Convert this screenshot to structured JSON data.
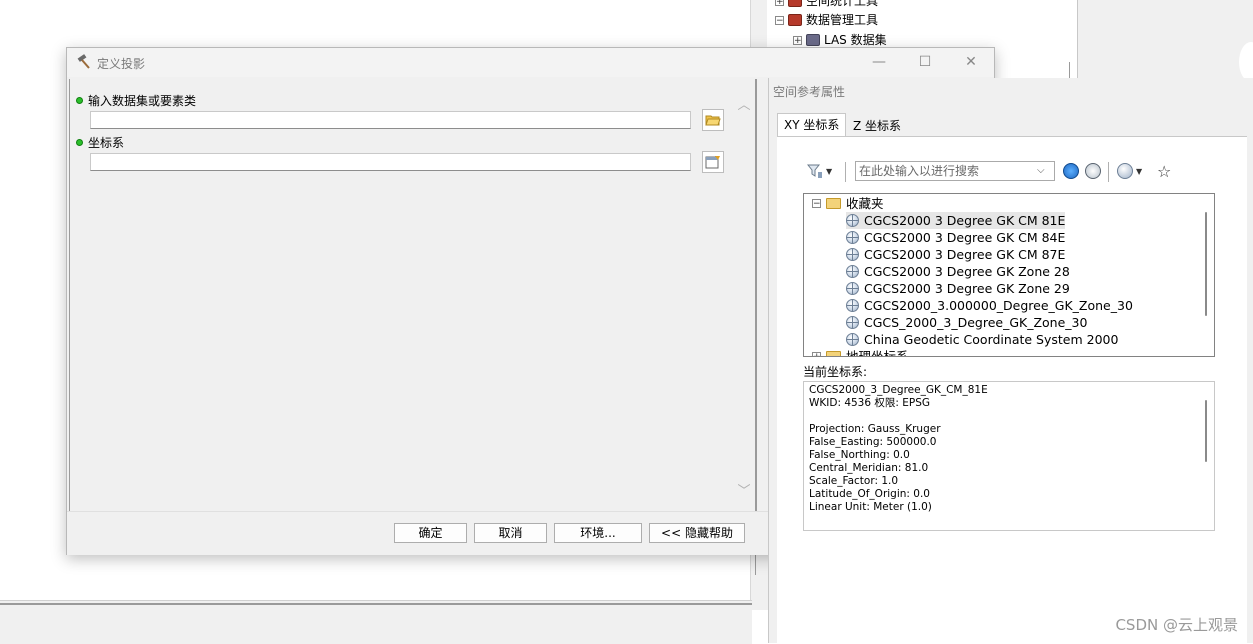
{
  "background": {
    "toolbox_tree": [
      {
        "label": "空间统计工具",
        "expander": "+"
      },
      {
        "label": "数据管理工具",
        "expander": "−"
      },
      {
        "label": "LAS 数据集",
        "expander": "+"
      }
    ]
  },
  "dialog": {
    "title": "定义投影",
    "params": [
      {
        "label": "输入数据集或要素类",
        "value": ""
      },
      {
        "label": "坐标系",
        "value": ""
      }
    ],
    "buttons": {
      "ok": "确定",
      "cancel": "取消",
      "environments": "环境...",
      "hide_help": "<< 隐藏帮助"
    }
  },
  "spatial_reference": {
    "title": "空间参考属性",
    "tabs": [
      "XY 坐标系",
      "Z 坐标系"
    ],
    "active_tab": "XY 坐标系",
    "search_placeholder": "在此处输入以进行搜索",
    "tree": {
      "favorites_label": "收藏夹",
      "favorites": [
        "CGCS2000 3 Degree GK CM 81E",
        "CGCS2000 3 Degree GK CM 84E",
        "CGCS2000 3 Degree GK CM 87E",
        "CGCS2000 3 Degree GK Zone 28",
        "CGCS2000 3 Degree GK Zone 29",
        "CGCS2000_3.000000_Degree_GK_Zone_30",
        "CGCS_2000_3_Degree_GK_Zone_30",
        "China Geodetic Coordinate System 2000"
      ],
      "next_folder_label": "地理坐标系",
      "selected_index": 0
    },
    "current_label": "当前坐标系:",
    "current_details": [
      "CGCS2000_3_Degree_GK_CM_81E",
      "WKID: 4536 权限: EPSG",
      "",
      "Projection: Gauss_Kruger",
      "False_Easting: 500000.0",
      "False_Northing: 0.0",
      "Central_Meridian: 81.0",
      "Scale_Factor: 1.0",
      "Latitude_Of_Origin: 0.0",
      "Linear Unit: Meter (1.0)"
    ]
  },
  "watermark": "CSDN @云上观景",
  "colors": {
    "param_dot": "#2bbf2b",
    "toolbox_icon": "#b63a2b",
    "folder": "#f3d37a"
  }
}
